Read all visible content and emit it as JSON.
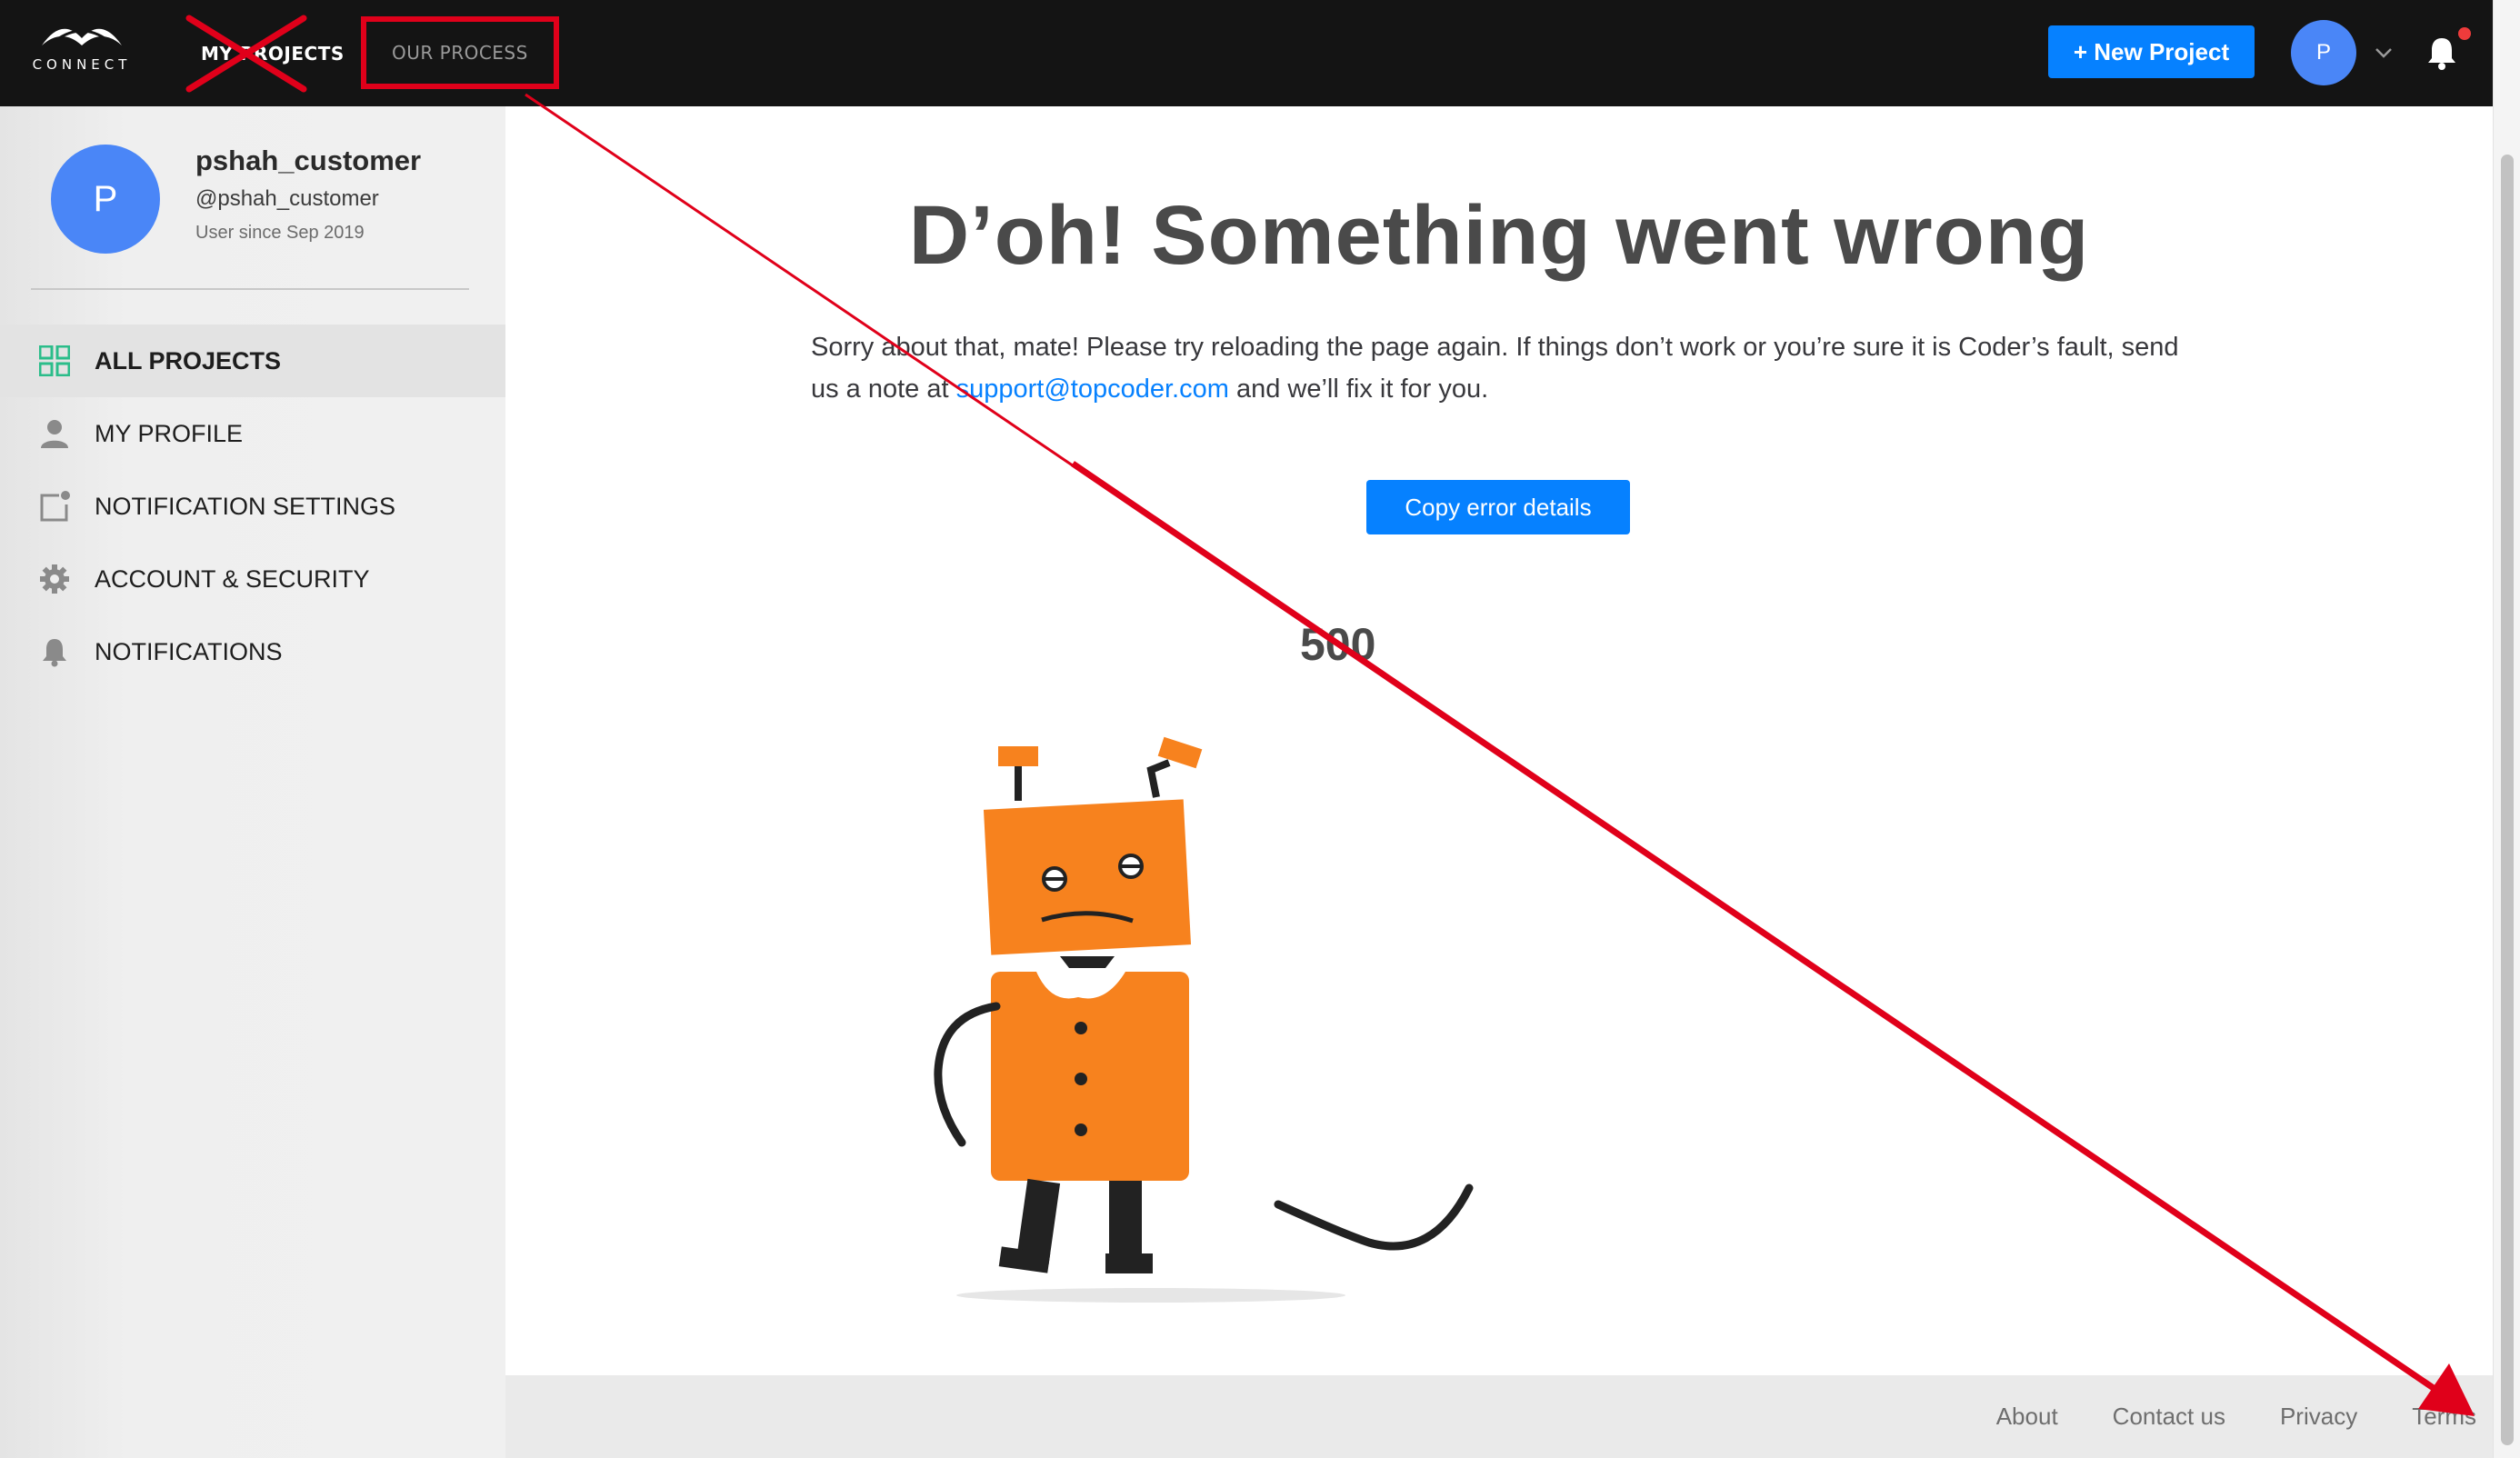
{
  "header": {
    "logo_text": "CONNECT",
    "nav": {
      "my_projects": "MY PROJECTS",
      "our_process": "OUR PROCESS"
    },
    "new_project_label": "+ New Project",
    "avatar_initial": "P"
  },
  "sidebar": {
    "avatar_initial": "P",
    "username": "pshah_customer",
    "handle": "@pshah_customer",
    "member_since": "User since Sep 2019",
    "items": [
      {
        "label": "ALL PROJECTS",
        "icon": "grid-icon",
        "active": true
      },
      {
        "label": "MY PROFILE",
        "icon": "person-icon",
        "active": false
      },
      {
        "label": "NOTIFICATION SETTINGS",
        "icon": "notification-settings-icon",
        "active": false
      },
      {
        "label": "ACCOUNT & SECURITY",
        "icon": "gear-icon",
        "active": false
      },
      {
        "label": "NOTIFICATIONS",
        "icon": "bell-icon",
        "active": false
      }
    ]
  },
  "main": {
    "title": "D’oh! Something went wrong",
    "message_before_link": "Sorry about that, mate! Please try reloading the page again. If things don’t work or you’re sure it is Coder’s fault, send us a note at ",
    "support_email": "support@topcoder.com",
    "message_after_link": " and we’ll fix it for you.",
    "copy_button_label": "Copy error details",
    "error_code": "500"
  },
  "footer": {
    "links": [
      "About",
      "Contact us",
      "Privacy",
      "Terms"
    ]
  },
  "colors": {
    "accent": "#0681ff",
    "topbar": "#141414",
    "robot_orange": "#f7821e",
    "annotation_red": "#e0001a",
    "bell_badge": "#ef3b3b"
  }
}
